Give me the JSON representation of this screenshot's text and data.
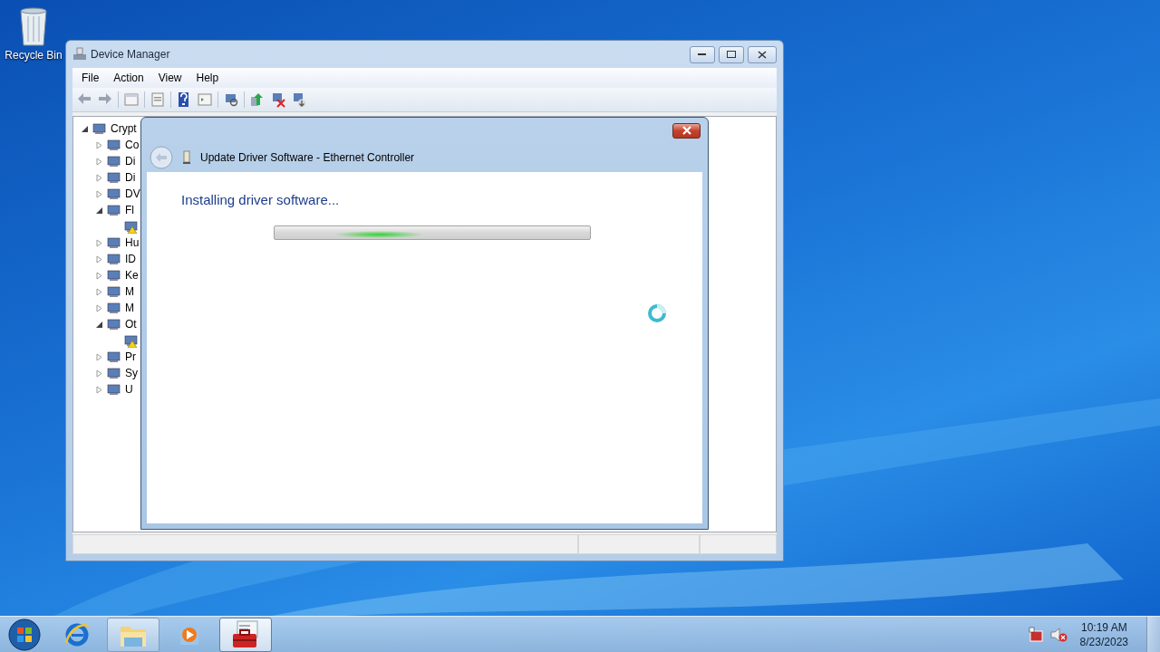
{
  "desktop_icons": [
    {
      "label": "Recycle Bin"
    }
  ],
  "device_manager": {
    "title": "Device Manager",
    "menu": [
      "File",
      "Action",
      "View",
      "Help"
    ],
    "tree": {
      "label": "Crypt",
      "expanded": true,
      "children": [
        {
          "label": "Co",
          "expanded": false
        },
        {
          "label": "Di",
          "expanded": false
        },
        {
          "label": "Di",
          "expanded": false
        },
        {
          "label": "DV",
          "expanded": false
        },
        {
          "label": "Fl",
          "expanded": true,
          "children": [
            {
              "warning": true
            }
          ]
        },
        {
          "label": "Hu",
          "expanded": false
        },
        {
          "label": "ID",
          "expanded": false
        },
        {
          "label": "Ke",
          "expanded": false
        },
        {
          "label": "M",
          "expanded": false
        },
        {
          "label": "M",
          "expanded": false
        },
        {
          "label": "Ot",
          "expanded": true,
          "children": [
            {
              "warning": true
            }
          ]
        },
        {
          "label": "Pr",
          "expanded": false
        },
        {
          "label": "Sy",
          "expanded": false
        },
        {
          "label": "U",
          "expanded": false
        }
      ]
    }
  },
  "dialog": {
    "title": "Update Driver Software - Ethernet Controller",
    "heading": "Installing driver software...",
    "progress": {
      "level": 0.33
    }
  },
  "taskbar": {
    "items": [
      {
        "kind": "browser",
        "running": false,
        "selected": false
      },
      {
        "kind": "folder",
        "running": true,
        "selected": false
      },
      {
        "kind": "media",
        "running": false,
        "selected": false
      },
      {
        "kind": "toolbox",
        "running": true,
        "selected": true
      }
    ],
    "tray": {
      "time": "10:19 AM",
      "date": "8/23/2023"
    }
  }
}
